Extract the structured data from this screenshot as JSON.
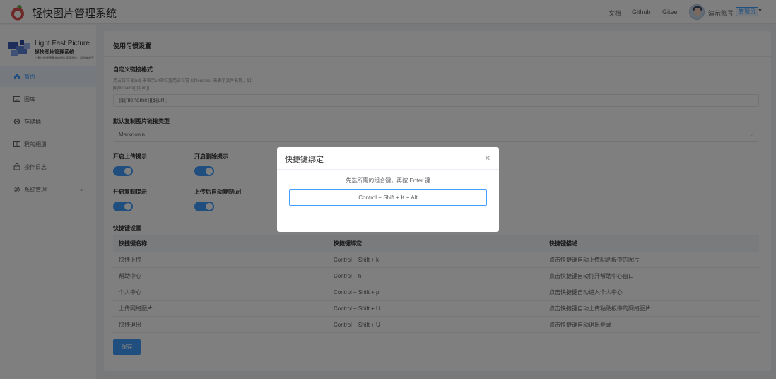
{
  "header": {
    "app_title": "轻快图片管理系统",
    "nav": [
      "文档",
      "Github",
      "Gitee"
    ],
    "user_name": "演示账号",
    "role_badge": "管理员"
  },
  "sidebar": {
    "brand_en": "Light Fast Picture",
    "brand_cn": "轻快图片管理系统",
    "brand_tagline": "一套快速便捷高效的图片管理系统，用起来顺手",
    "items": [
      {
        "label": "首页",
        "icon": "home-icon",
        "active": true
      },
      {
        "label": "图库",
        "icon": "image-icon",
        "active": false
      },
      {
        "label": "存储桶",
        "icon": "bucket-icon",
        "active": false
      },
      {
        "label": "我的相册",
        "icon": "album-icon",
        "active": false
      },
      {
        "label": "操作日志",
        "icon": "log-icon",
        "active": false
      },
      {
        "label": "系统管理",
        "icon": "gear-icon",
        "active": false
      }
    ]
  },
  "settings": {
    "title": "使用习惯设置",
    "link_format_label": "自定义链接格式",
    "link_format_hint": "用占位符 ${url} 来表示url的位置用占位符 ${filename} 来表示文件名称，如：[${filename}](${url})",
    "link_format_value": "[${filename}](${url})",
    "copy_type_label": "默认复制图片链接类型",
    "copy_type_value": "Markdown",
    "switches": [
      {
        "label": "开启上传提示",
        "on": true
      },
      {
        "label": "开启删除提示",
        "on": true
      },
      {
        "label": "开启复制提示",
        "on": true
      },
      {
        "label": "上传后自动复制url",
        "on": true
      }
    ],
    "shortcut_section_label": "快捷键设置",
    "save_label": "保存"
  },
  "table": {
    "headers": [
      "快捷键名称",
      "快捷键绑定",
      "快捷键描述"
    ],
    "rows": [
      [
        "快捷上传",
        "Control + Shift + k",
        "点击快捷键自动上传粘贴板中的图片"
      ],
      [
        "帮助中心",
        "Control + h",
        "点击快捷键自动打开帮助中心窗口"
      ],
      [
        "个人中心",
        "Control + Shift + p",
        "点击快捷键自动进入个人中心"
      ],
      [
        "上传网络图片",
        "Control + Shift + U",
        "点击快捷键自动上传粘贴板中的网络图片"
      ],
      [
        "快捷退出",
        "Control + Shift + U",
        "点击快捷键自动退出登录"
      ]
    ]
  },
  "dialog": {
    "title": "快捷键绑定",
    "hint": "先选所需的组合键，再按 Enter 键",
    "value": "Control + Shift + K + Alt"
  },
  "colors": {
    "accent": "#409eff",
    "overlay": "rgba(0,0,0,0.5)"
  }
}
